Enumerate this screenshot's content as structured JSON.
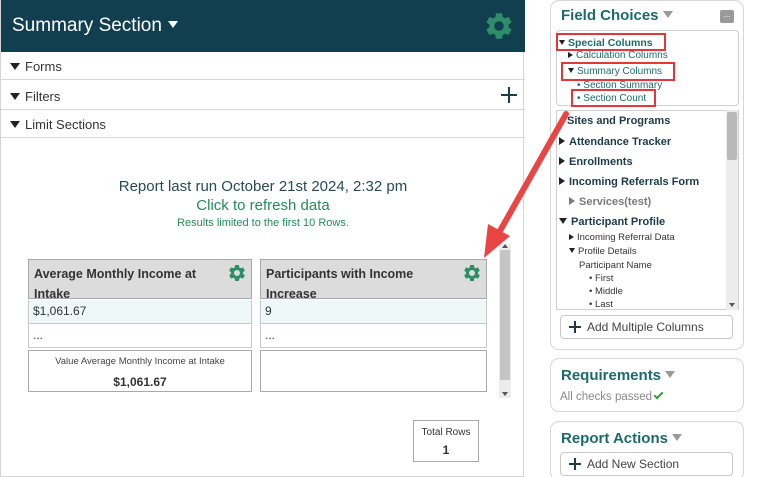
{
  "summary": {
    "title": "Summary Section",
    "sections": [
      "Forms",
      "Filters",
      "Limit Sections"
    ],
    "report_run": "Report last run October 21st 2024, 2:32 pm",
    "refresh": "Click to refresh data",
    "limit_note": "Results limited to the first 10 Rows.",
    "columns": [
      {
        "title": "Average Monthly Income at Intake",
        "value": "$1,061.67",
        "more": "...",
        "agg_label": "Value Average Monthly Income at Intake",
        "agg_value": "$1,061.67"
      },
      {
        "title": "Participants with Income Increase",
        "value": "9",
        "more": "...",
        "agg_label": "",
        "agg_value": ""
      }
    ],
    "total_rows_label": "Total Rows",
    "total_rows_value": "1"
  },
  "field_choices": {
    "title": "Field Choices",
    "menu_icon": "...",
    "tree": {
      "special_columns": "Special Columns",
      "calculation_columns": "Calculation Columns",
      "summary_columns": "Summary Columns",
      "section_summary": "• Section Summary",
      "section_count": "• Section Count"
    },
    "list": {
      "sites": "Sites and Programs",
      "attendance": "Attendance Tracker",
      "enrollments": "Enrollments",
      "incoming_form": "Incoming Referrals Form",
      "services": "Services(test)",
      "participant_profile": "Participant Profile",
      "incoming_data": "Incoming Referral Data",
      "profile_details": "Profile Details",
      "participant_name": "Participant Name",
      "first": "• First",
      "middle": "• Middle",
      "last": "• Last"
    },
    "add_multiple": "Add Multiple Columns"
  },
  "requirements": {
    "title": "Requirements",
    "status": "All checks passed"
  },
  "report_actions": {
    "title": "Report Actions",
    "add_section": "Add New Section"
  },
  "colors": {
    "header_bg": "#113f4f",
    "accent_green": "#258a5a",
    "gear": "#2e7d6b",
    "highlight": "#e3383a",
    "panel_title": "#1d6a6c"
  }
}
